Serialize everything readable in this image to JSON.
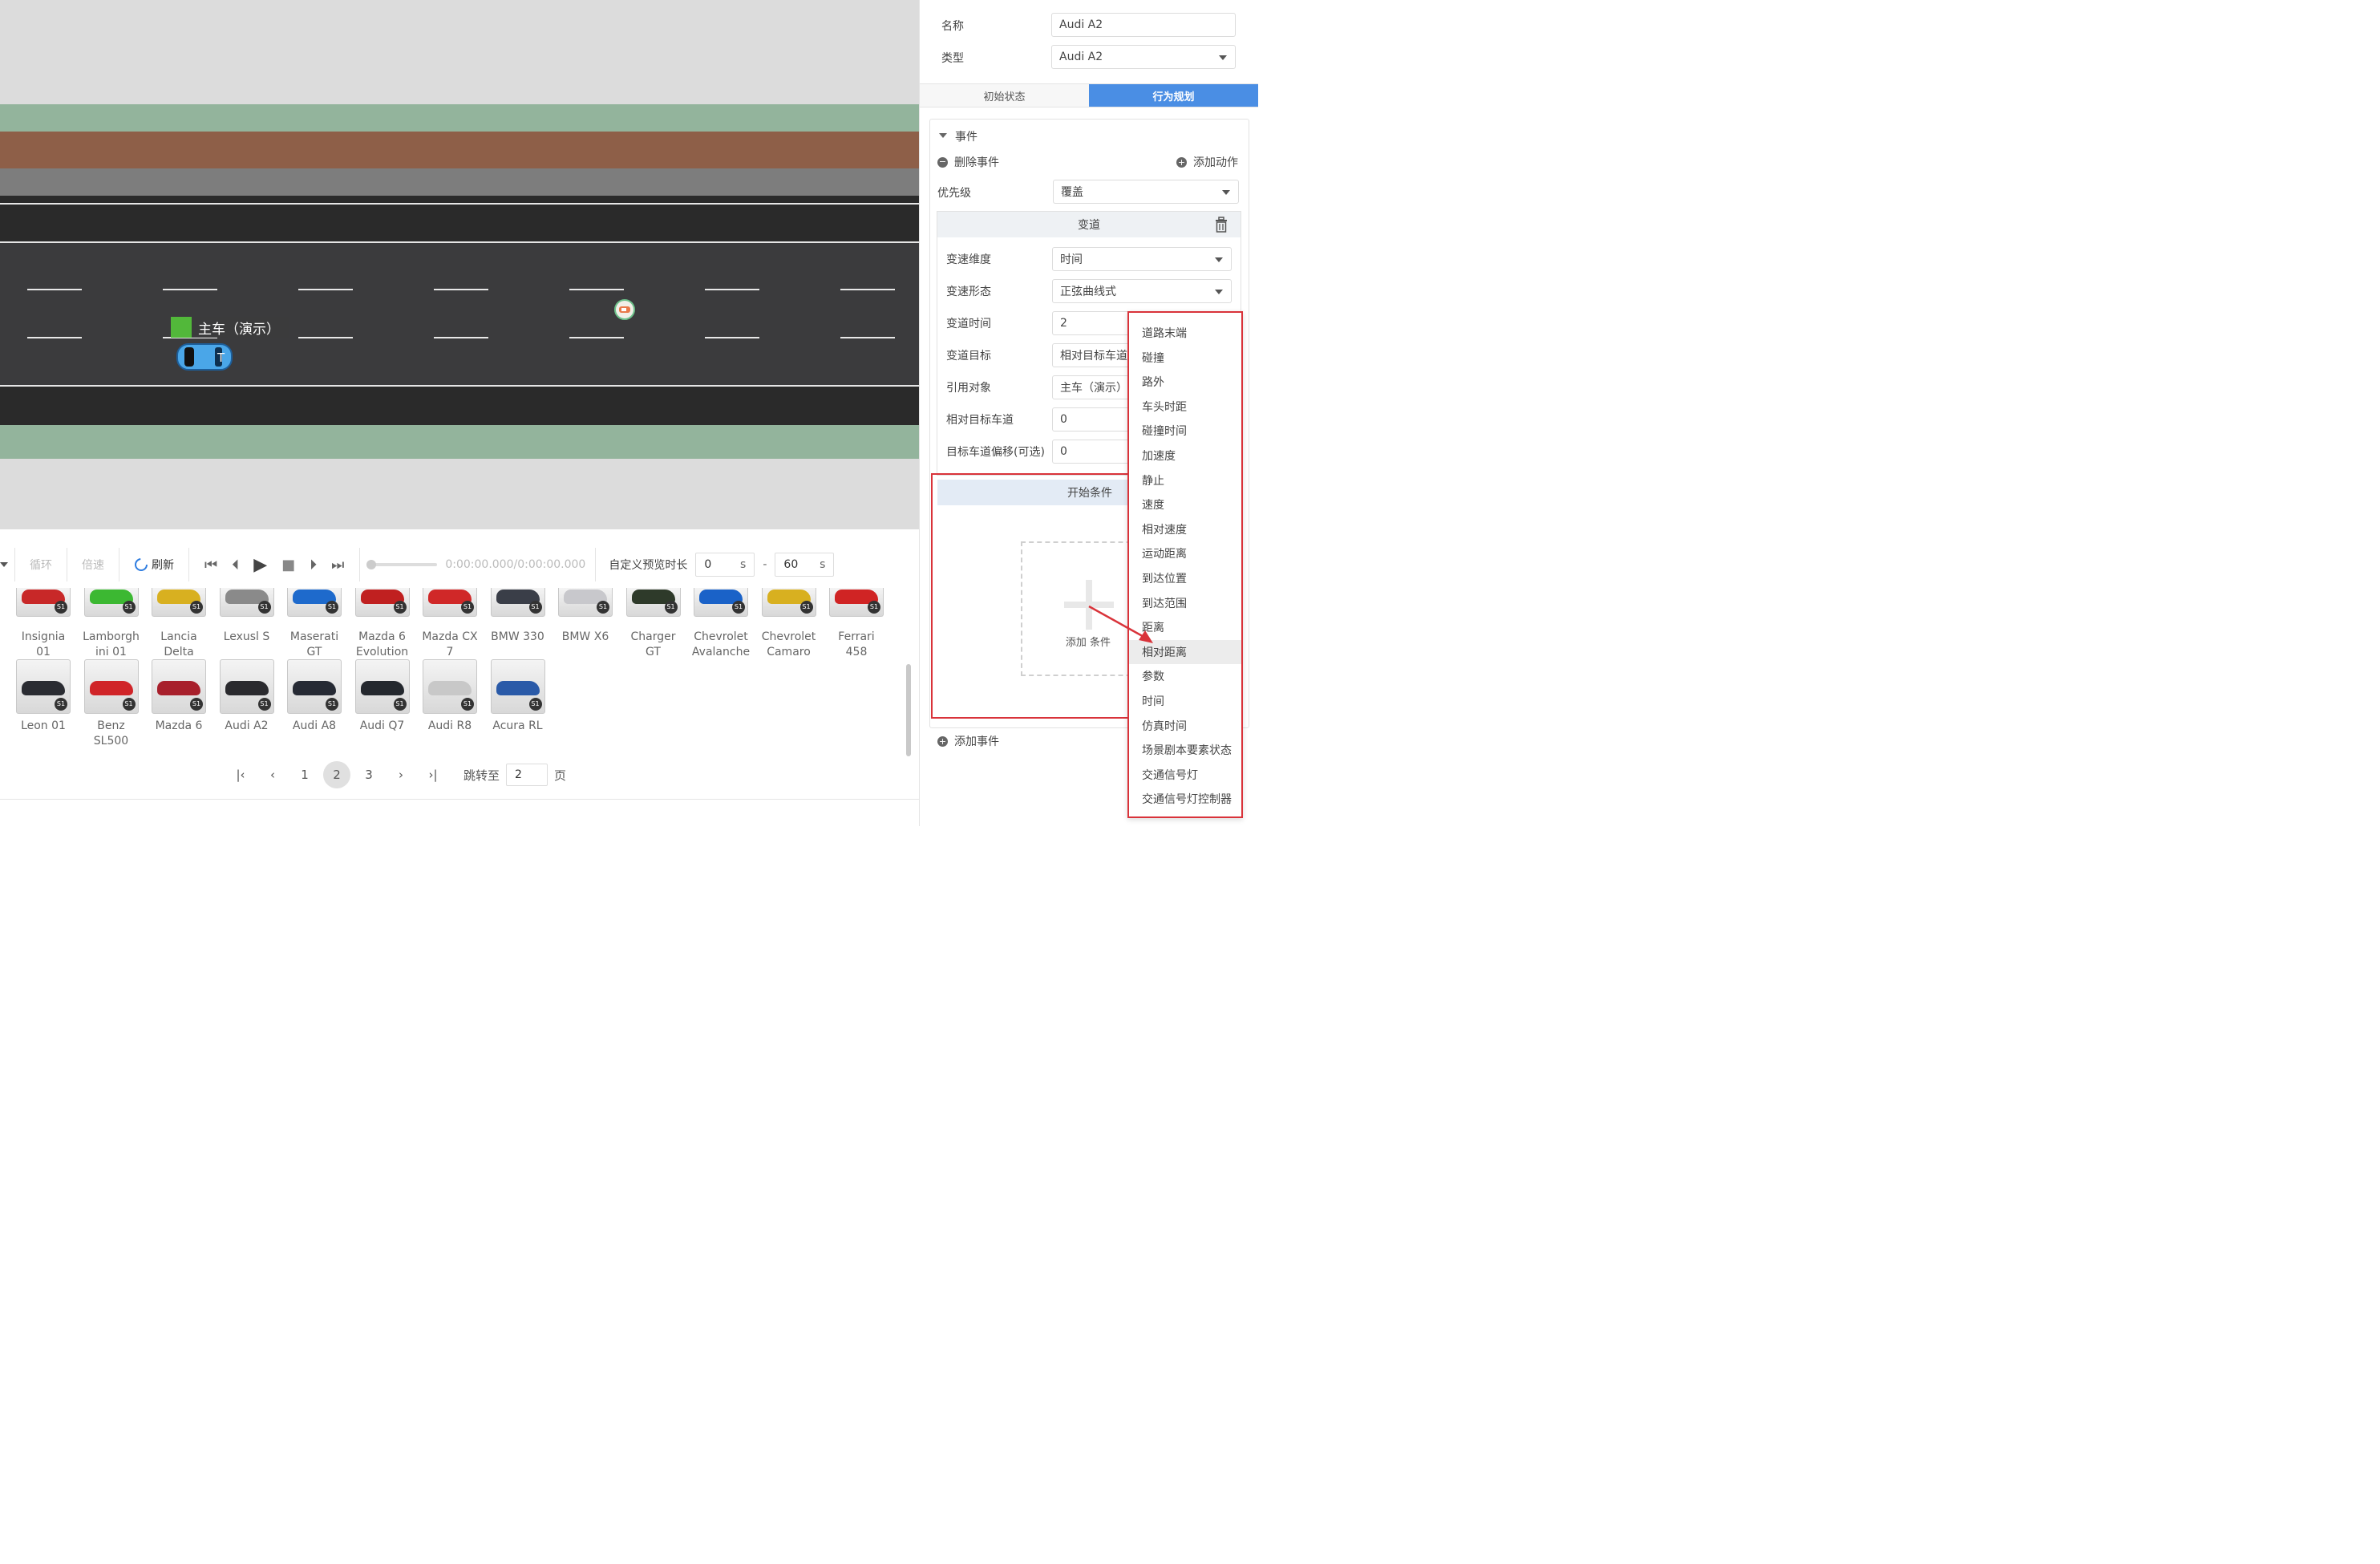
{
  "viewport": {
    "vehicle_label": "主车（演示）",
    "vehicle_marker": "T"
  },
  "toolbar": {
    "loop": "循环",
    "speed": "倍速",
    "refresh": "刷新",
    "time_display": "0:00:00.000/0:00:00.000",
    "preview_duration_label": "自定义预览时长",
    "start_value": "0",
    "end_value": "60",
    "unit": "s",
    "dash": "-"
  },
  "gallery": {
    "row1": [
      {
        "name": "Insignia 01",
        "color": "#c82828"
      },
      {
        "name": "Lamborghini 01",
        "color": "#3cb832"
      },
      {
        "name": "Lancia Delta",
        "color": "#d8b020"
      },
      {
        "name": "Lexusl S",
        "color": "#8a8a8a"
      },
      {
        "name": "Maserati GT",
        "color": "#1e6acc"
      },
      {
        "name": "Mazda 6 Evolution",
        "color": "#c02020"
      },
      {
        "name": "Mazda CX 7",
        "color": "#d02828"
      },
      {
        "name": "BMW 330",
        "color": "#3a3e48"
      },
      {
        "name": "BMW X6",
        "color": "#c8c8cc"
      },
      {
        "name": "Charger GT",
        "color": "#2e3a2a"
      },
      {
        "name": "Chevrolet Avalanche",
        "color": "#1a62c8"
      },
      {
        "name": "Chevrolet Camaro",
        "color": "#d8b020"
      },
      {
        "name": "Ferrari 458",
        "color": "#d02424"
      }
    ],
    "row1_labels": [
      [
        "Insignia",
        "01"
      ],
      [
        "Lamborgh",
        "ini 01"
      ],
      [
        "Lancia",
        "Delta"
      ],
      [
        "Lexusl S",
        ""
      ],
      [
        "Maserati",
        "GT"
      ],
      [
        "Mazda 6",
        "Evolution"
      ],
      [
        "Mazda CX",
        "7"
      ],
      [
        "BMW 330",
        ""
      ],
      [
        "BMW X6",
        ""
      ],
      [
        "Charger",
        "GT"
      ],
      [
        "Chevrolet",
        "Avalanche"
      ],
      [
        "Chevrolet",
        "Camaro"
      ],
      [
        "Ferrari",
        "458"
      ]
    ],
    "row2": [
      {
        "name": "Leon 01",
        "l1": "Leon 01",
        "l2": "",
        "color": "#2a2c32"
      },
      {
        "name": "Benz SL500",
        "l1": "Benz",
        "l2": "SL500",
        "color": "#d02428"
      },
      {
        "name": "Mazda 6",
        "l1": "Mazda 6",
        "l2": "",
        "color": "#a8202c"
      },
      {
        "name": "Audi A2",
        "l1": "Audi A2",
        "l2": "",
        "color": "#2a2a2e"
      },
      {
        "name": "Audi A8",
        "l1": "Audi A8",
        "l2": "",
        "color": "#262a34"
      },
      {
        "name": "Audi Q7",
        "l1": "Audi Q7",
        "l2": "",
        "color": "#24282e"
      },
      {
        "name": "Audi R8",
        "l1": "Audi R8",
        "l2": "",
        "color": "#c8c8c8"
      },
      {
        "name": "Acura RL",
        "l1": "Acura RL",
        "l2": "",
        "color": "#2a5aa8"
      }
    ],
    "badge": "S1"
  },
  "pager": {
    "pages": [
      "1",
      "2",
      "3"
    ],
    "current": "2",
    "jump_label": "跳转至",
    "jump_value": "2",
    "page_suffix": "页"
  },
  "panel": {
    "name_label": "名称",
    "name_value": "Audi A2",
    "type_label": "类型",
    "type_value": "Audi A2",
    "tabs": [
      "初始状态",
      "行为规划"
    ],
    "event_label": "事件",
    "delete_event": "删除事件",
    "add_action": "添加动作",
    "priority_label": "优先级",
    "priority_value": "覆盖",
    "action_title": "变道",
    "fields": [
      {
        "label": "变速维度",
        "value": "时间"
      },
      {
        "label": "变速形态",
        "value": "正弦曲线式"
      },
      {
        "label": "变道时间",
        "value": "2"
      },
      {
        "label": "变道目标",
        "value": "相对目标车道"
      },
      {
        "label": "引用对象",
        "value": "主车（演示）"
      },
      {
        "label": "相对目标车道",
        "value": "0"
      },
      {
        "label": "目标车道偏移(可选)",
        "value": "0"
      }
    ],
    "start_condition": "开始条件",
    "add_condition": "添加 条件",
    "add_event": "添加事件"
  },
  "dropdown": {
    "items": [
      "道路末端",
      "碰撞",
      "路外",
      "车头时距",
      "碰撞时间",
      "加速度",
      "静止",
      "速度",
      "相对速度",
      "运动距离",
      "到达位置",
      "到达范围",
      "距离",
      "相对距离",
      "参数",
      "时间",
      "仿真时间",
      "场景剧本要素状态",
      "交通信号灯",
      "交通信号灯控制器"
    ],
    "highlighted": "相对距离"
  },
  "colors": {
    "accent": "#4a8ee4",
    "highlight_red": "#d9333a",
    "road": "#3a3a3a",
    "grass": "#93b49c",
    "dirt": "#8e5f48",
    "ego_car": "#4aa6e8"
  }
}
